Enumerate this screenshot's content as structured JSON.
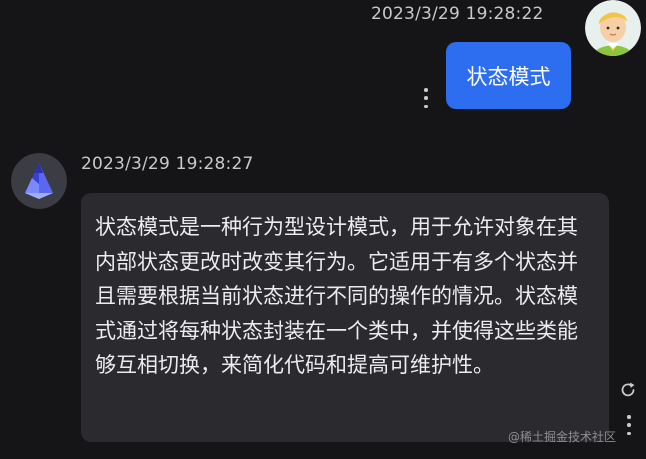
{
  "user_message": {
    "timestamp": "2023/3/29 19:28:22",
    "text": "状态模式"
  },
  "bot_message": {
    "timestamp": "2023/3/29 19:28:27",
    "text": "状态模式是一种行为型设计模式，用于允许对象在其内部状态更改时改变其行为。它适用于有多个状态并且需要根据当前状态进行不同的操作的情况。状态模式通过将每种状态封装在一个类中，并使得这些类能够互相切换，来简化代码和提高可维护性。"
  },
  "icons": {
    "user_avatar": "cartoon-user-avatar-icon",
    "bot_avatar": "blue-pyramid-avatar-icon",
    "more": "vertical-ellipsis-icon",
    "refresh": "refresh-icon"
  },
  "colors": {
    "background": "#151518",
    "user_bubble": "#2d6df0",
    "bot_bubble": "#2b2b2f",
    "text": "#ececef"
  },
  "watermark": "@稀土掘金技术社区"
}
